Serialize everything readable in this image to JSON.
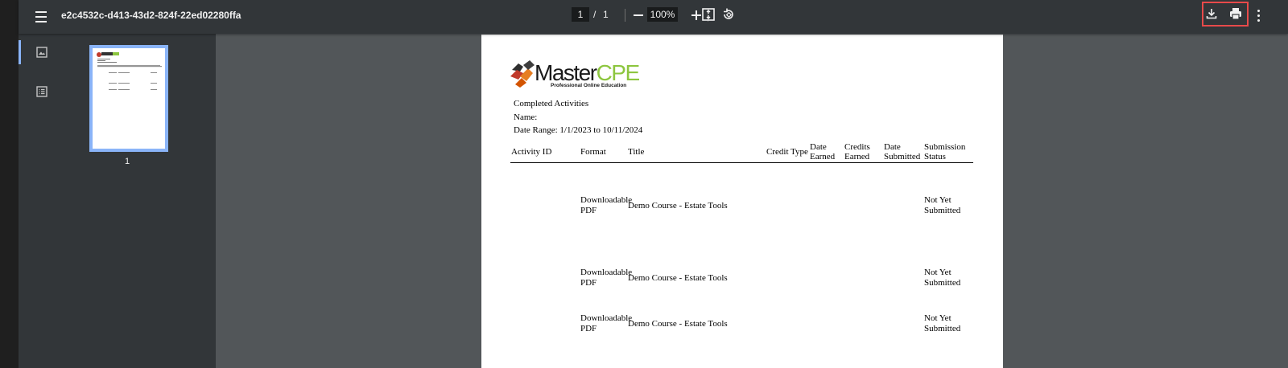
{
  "toolbar": {
    "title": "e2c4532c-d413-43d2-824f-22ed02280ffa",
    "page_current": "1",
    "page_sep": "/",
    "page_total": "1",
    "zoom": "100%"
  },
  "sidebar": {
    "thumbnail_page_label": "1"
  },
  "document": {
    "logo": {
      "master": "Master",
      "cpe": "CPE",
      "tagline": "Professional Online Education"
    },
    "heading": "Completed Activities",
    "name_label": "Name:",
    "date_range": "Date Range: 1/1/2023 to 10/11/2024",
    "columns": [
      "Activity ID",
      "Format",
      "Title",
      "Credit Type",
      "Date Earned",
      "Credits Earned",
      "Date Submitted",
      "Submission Status"
    ],
    "rows": [
      {
        "format": "Downloadable PDF",
        "title": "Demo Course - Estate Tools",
        "status": "Not Yet Submitted"
      },
      {
        "format": "Downloadable PDF",
        "title": "Demo Course - Estate Tools",
        "status": "Not Yet Submitted"
      },
      {
        "format": "Downloadable PDF",
        "title": "Demo Course - Estate Tools",
        "status": "Not Yet Submitted"
      }
    ]
  },
  "icons": {
    "menu": "hamburger-icon",
    "fit": "fit-to-page-icon",
    "rotate": "rotate-icon",
    "download": "download-icon",
    "print": "print-icon",
    "more": "more-vertical-icon",
    "thumbnails": "image-icon",
    "outline": "list-icon"
  },
  "colors": {
    "toolbar": "#323639",
    "viewer_bg": "#525659",
    "accent": "#8ab4f8",
    "highlight": "#e84a4a",
    "logo_green": "#8dc63f"
  }
}
